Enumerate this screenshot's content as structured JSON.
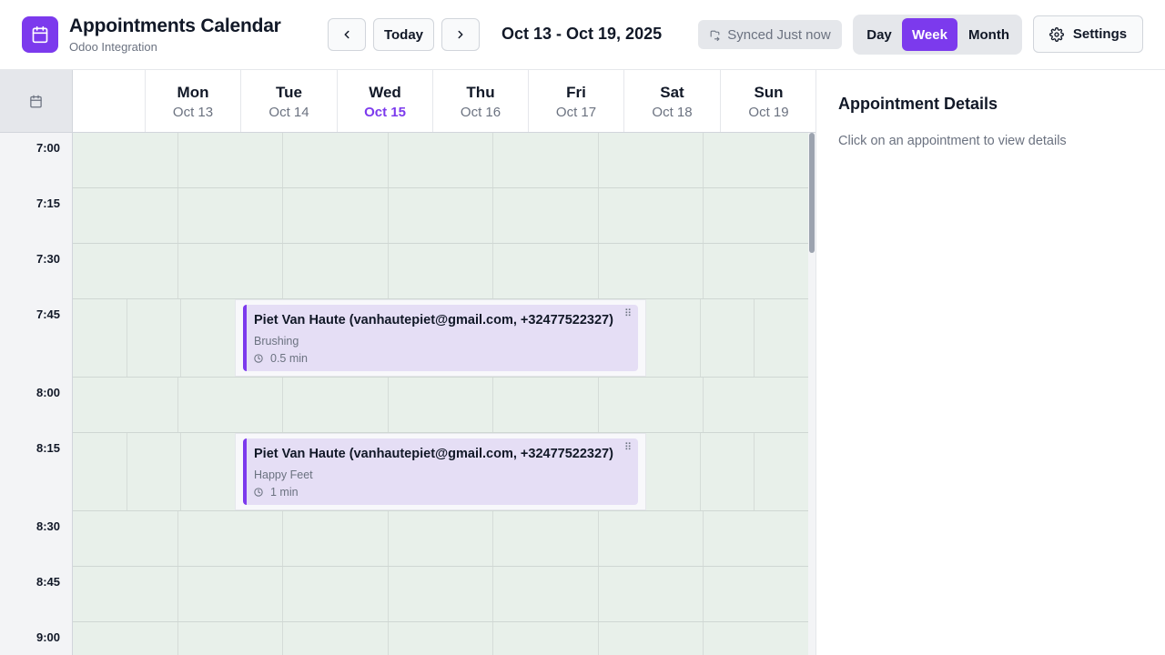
{
  "app": {
    "title": "Appointments Calendar",
    "subtitle": "Odoo Integration",
    "icon": "calendar-icon",
    "accent": "#7c3aed"
  },
  "toolbar": {
    "prev_icon": "chevron-left-icon",
    "today_label": "Today",
    "next_icon": "chevron-right-icon",
    "date_range": "Oct 13 - Oct 19, 2025",
    "sync_label": "Synced Just now",
    "sync_icon": "cloud-sync-icon",
    "views": [
      "Day",
      "Week",
      "Month"
    ],
    "active_view": "Week",
    "settings_label": "Settings",
    "settings_icon": "gear-icon"
  },
  "calendar": {
    "days": [
      {
        "name": "Mon",
        "date": "Oct 13",
        "today": false
      },
      {
        "name": "Tue",
        "date": "Oct 14",
        "today": false
      },
      {
        "name": "Wed",
        "date": "Oct 15",
        "today": true
      },
      {
        "name": "Thu",
        "date": "Oct 16",
        "today": false
      },
      {
        "name": "Fri",
        "date": "Oct 17",
        "today": false
      },
      {
        "name": "Sat",
        "date": "Oct 18",
        "today": false
      },
      {
        "name": "Sun",
        "date": "Oct 19",
        "today": false
      }
    ],
    "time_slots": [
      "7:00",
      "7:15",
      "7:30",
      "7:45",
      "8:00",
      "8:15",
      "8:30",
      "8:45",
      "9:00"
    ],
    "events": [
      {
        "slot": "7:45",
        "title": "Piet Van Haute (vanhautepiet@gmail.com, +32477522327)",
        "type": "Brushing",
        "duration": "0.5 min"
      },
      {
        "slot": "8:15",
        "title": "Piet Van Haute (vanhautepiet@gmail.com, +32477522327)",
        "type": "Happy Feet",
        "duration": "1 min"
      }
    ]
  },
  "details": {
    "title": "Appointment Details",
    "hint": "Click on an appointment to view details"
  }
}
